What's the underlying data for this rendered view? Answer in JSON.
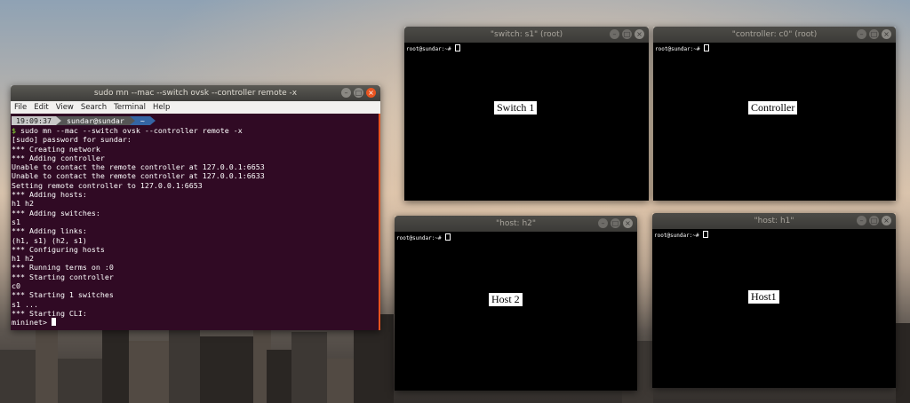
{
  "main_terminal": {
    "title": "sudo mn --mac --switch ovsk --controller remote -x",
    "menu": [
      "File",
      "Edit",
      "View",
      "Search",
      "Terminal",
      "Help"
    ],
    "prompt": {
      "time": "19:09:37",
      "user": "sundar@sundar",
      "dir": "~"
    },
    "command_prefix": "$",
    "command": " sudo mn --mac --switch ovsk --controller remote -x",
    "output": [
      "[sudo] password for sundar:",
      "*** Creating network",
      "*** Adding controller",
      "Unable to contact the remote controller at 127.0.0.1:6653",
      "Unable to contact the remote controller at 127.0.0.1:6633",
      "Setting remote controller to 127.0.0.1:6653",
      "*** Adding hosts:",
      "h1 h2",
      "*** Adding switches:",
      "s1",
      "*** Adding links:",
      "(h1, s1) (h2, s1)",
      "*** Configuring hosts",
      "h1 h2",
      "*** Running terms on :0",
      "*** Starting controller",
      "c0",
      "*** Starting 1 switches",
      "s1 ...",
      "*** Starting CLI:"
    ],
    "final_prompt": "mininet> "
  },
  "xterms": {
    "switch": {
      "title": "\"switch: s1\" (root)",
      "prompt": "root@sundar:~# ",
      "label": "Switch  1"
    },
    "controller": {
      "title": "\"controller: c0\" (root)",
      "prompt": "root@sundar:~# ",
      "label": "Controller"
    },
    "host_h2": {
      "title": "\"host: h2\"",
      "prompt": "root@sundar:~# ",
      "label": "Host  2"
    },
    "host_h1": {
      "title": "\"host: h1\"",
      "prompt": "root@sundar:~# ",
      "label": "Host1"
    }
  },
  "window_controls": {
    "minimize": "–",
    "maximize": "□",
    "close": "×"
  },
  "colors": {
    "terminal_bg": "#300a24",
    "ubuntu_orange": "#e95420",
    "prompt_green": "#8ae234",
    "powerline_blue": "#3465a4"
  }
}
